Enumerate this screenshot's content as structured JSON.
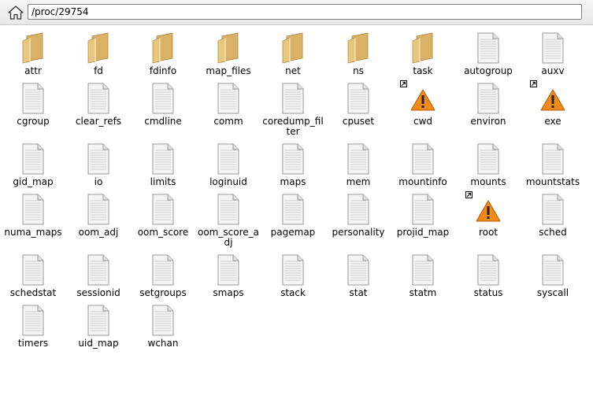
{
  "location": {
    "path": "/proc/29754"
  },
  "files": [
    {
      "name": "attr",
      "type": "folder"
    },
    {
      "name": "fd",
      "type": "folder"
    },
    {
      "name": "fdinfo",
      "type": "folder"
    },
    {
      "name": "map_files",
      "type": "folder"
    },
    {
      "name": "net",
      "type": "folder"
    },
    {
      "name": "ns",
      "type": "folder"
    },
    {
      "name": "task",
      "type": "folder"
    },
    {
      "name": "autogroup",
      "type": "file"
    },
    {
      "name": "auxv",
      "type": "file"
    },
    {
      "name": "cgroup",
      "type": "file"
    },
    {
      "name": "clear_refs",
      "type": "file"
    },
    {
      "name": "cmdline",
      "type": "file"
    },
    {
      "name": "comm",
      "type": "file"
    },
    {
      "name": "coredump_filter",
      "type": "file"
    },
    {
      "name": "cpuset",
      "type": "file"
    },
    {
      "name": "cwd",
      "type": "broken-link"
    },
    {
      "name": "environ",
      "type": "file"
    },
    {
      "name": "exe",
      "type": "broken-link"
    },
    {
      "name": "gid_map",
      "type": "file"
    },
    {
      "name": "io",
      "type": "file"
    },
    {
      "name": "limits",
      "type": "file"
    },
    {
      "name": "loginuid",
      "type": "file"
    },
    {
      "name": "maps",
      "type": "file"
    },
    {
      "name": "mem",
      "type": "file"
    },
    {
      "name": "mountinfo",
      "type": "file"
    },
    {
      "name": "mounts",
      "type": "file"
    },
    {
      "name": "mountstats",
      "type": "file"
    },
    {
      "name": "numa_maps",
      "type": "file"
    },
    {
      "name": "oom_adj",
      "type": "file"
    },
    {
      "name": "oom_score",
      "type": "file"
    },
    {
      "name": "oom_score_adj",
      "type": "file"
    },
    {
      "name": "pagemap",
      "type": "file"
    },
    {
      "name": "personality",
      "type": "file"
    },
    {
      "name": "projid_map",
      "type": "file"
    },
    {
      "name": "root",
      "type": "broken-link"
    },
    {
      "name": "sched",
      "type": "file"
    },
    {
      "name": "schedstat",
      "type": "file"
    },
    {
      "name": "sessionid",
      "type": "file"
    },
    {
      "name": "setgroups",
      "type": "file"
    },
    {
      "name": "smaps",
      "type": "file"
    },
    {
      "name": "stack",
      "type": "file"
    },
    {
      "name": "stat",
      "type": "file"
    },
    {
      "name": "statm",
      "type": "file"
    },
    {
      "name": "status",
      "type": "file"
    },
    {
      "name": "syscall",
      "type": "file"
    },
    {
      "name": "timers",
      "type": "file"
    },
    {
      "name": "uid_map",
      "type": "file"
    },
    {
      "name": "wchan",
      "type": "file"
    }
  ],
  "colors": {
    "folder": "#e8c77e",
    "warning": "#f08a1c",
    "file_page": "#f4f4f4"
  }
}
